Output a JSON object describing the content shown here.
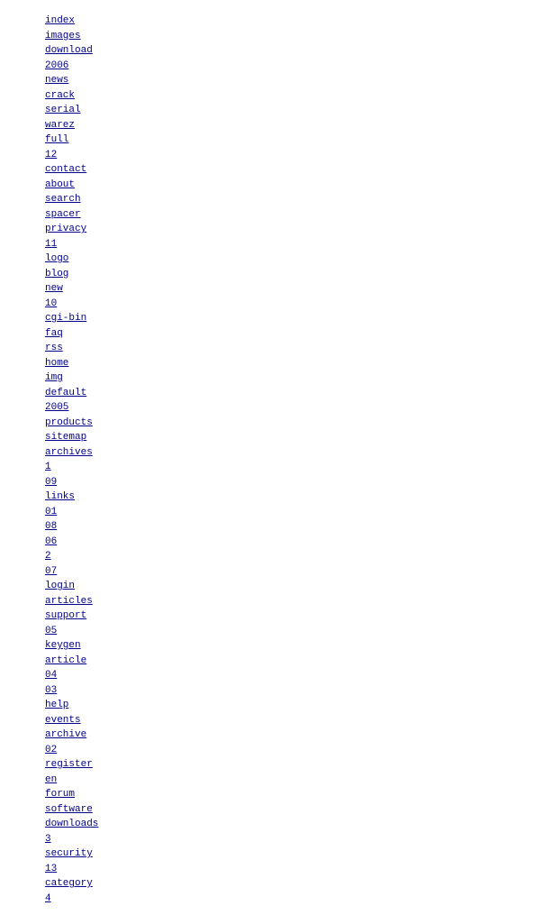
{
  "links": [
    {
      "label": "index"
    },
    {
      "label": "images"
    },
    {
      "label": "download"
    },
    {
      "label": "2006"
    },
    {
      "label": "news"
    },
    {
      "label": "crack"
    },
    {
      "label": "serial"
    },
    {
      "label": "warez"
    },
    {
      "label": "full"
    },
    {
      "label": "12"
    },
    {
      "label": "contact"
    },
    {
      "label": "about"
    },
    {
      "label": "search"
    },
    {
      "label": "spacer"
    },
    {
      "label": "privacy"
    },
    {
      "label": "11"
    },
    {
      "label": "logo"
    },
    {
      "label": "blog"
    },
    {
      "label": "new"
    },
    {
      "label": "10"
    },
    {
      "label": "cgi-bin"
    },
    {
      "label": "faq"
    },
    {
      "label": "rss"
    },
    {
      "label": "home"
    },
    {
      "label": "img"
    },
    {
      "label": "default"
    },
    {
      "label": "2005"
    },
    {
      "label": "products"
    },
    {
      "label": "sitemap"
    },
    {
      "label": "archives"
    },
    {
      "label": "1"
    },
    {
      "label": "09"
    },
    {
      "label": "links"
    },
    {
      "label": "01"
    },
    {
      "label": "08"
    },
    {
      "label": "06"
    },
    {
      "label": "2"
    },
    {
      "label": "07"
    },
    {
      "label": "login"
    },
    {
      "label": "articles"
    },
    {
      "label": "support"
    },
    {
      "label": "05"
    },
    {
      "label": "keygen"
    },
    {
      "label": "article"
    },
    {
      "label": "04"
    },
    {
      "label": "03"
    },
    {
      "label": "help"
    },
    {
      "label": "events"
    },
    {
      "label": "archive"
    },
    {
      "label": "02"
    },
    {
      "label": "register"
    },
    {
      "label": "en"
    },
    {
      "label": "forum"
    },
    {
      "label": "software"
    },
    {
      "label": "downloads"
    },
    {
      "label": "3"
    },
    {
      "label": "security"
    },
    {
      "label": "13"
    },
    {
      "label": "category"
    },
    {
      "label": "4"
    }
  ]
}
